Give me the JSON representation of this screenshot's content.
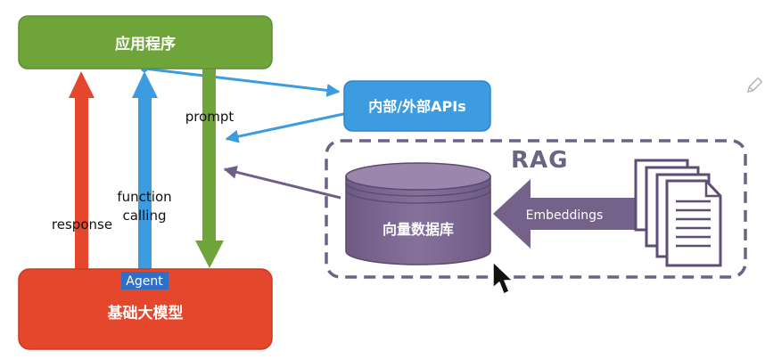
{
  "nodes": {
    "app": {
      "label": "应用程序"
    },
    "llm": {
      "label": "基础大模型",
      "tag": "Agent"
    },
    "api": {
      "label": "内部/外部APIs"
    },
    "vdb": {
      "label": "向量数据库"
    },
    "rag": {
      "label": "RAG"
    }
  },
  "edges": {
    "response": "response",
    "function_calling_line1": "function",
    "function_calling_line2": "calling",
    "prompt": "prompt",
    "embeddings": "Embeddings"
  },
  "colors": {
    "app_green": "#6fa43a",
    "llm_red": "#e5472c",
    "api_blue": "#3d9be0",
    "vdb_purple": "#7f6a93",
    "rag_border": "#6b6384",
    "agent_highlight": "#2f6fc8"
  },
  "icons": {
    "documents": "document-stack-icon",
    "cursor": "mouse-pointer-icon",
    "edit": "pencil-icon"
  }
}
